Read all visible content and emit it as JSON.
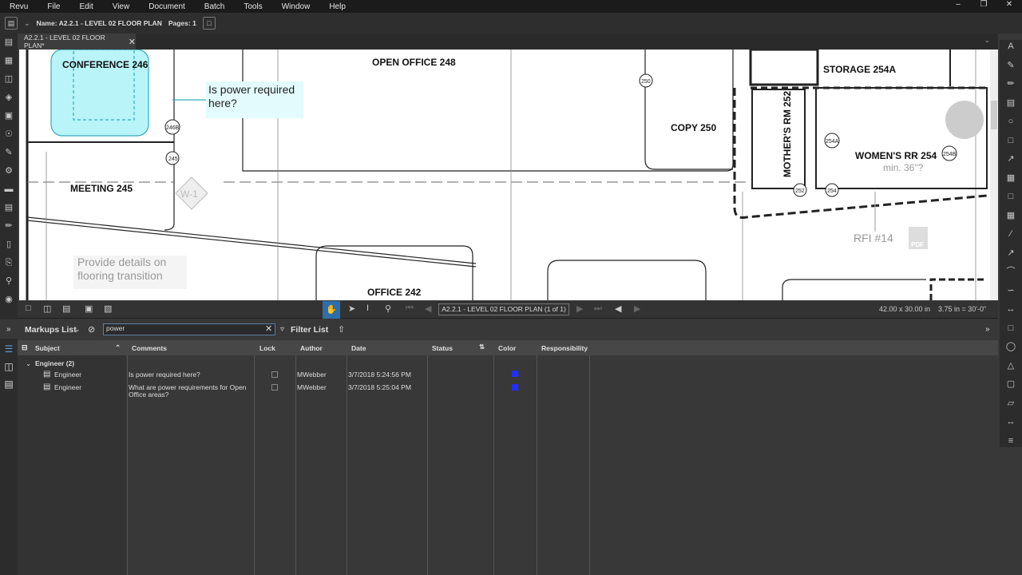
{
  "menu": [
    "Revu",
    "File",
    "Edit",
    "View",
    "Document",
    "Batch",
    "Tools",
    "Window",
    "Help"
  ],
  "toolbar": {
    "name_label": "Name: A2.2.1 - LEVEL 02 FLOOR PLAN",
    "pages_label": "Pages: 1"
  },
  "tab": {
    "label": "A2.2.1 - LEVEL 02 FLOOR PLAN*"
  },
  "drawing": {
    "rooms": [
      "CONFERENCE 246",
      "OPEN OFFICE 248",
      "COPY 250",
      "STORAGE 254A",
      "MOTHER'S RM 252",
      "WOMEN'S RR 254",
      "MEETING 245",
      "OFFICE 242"
    ],
    "tags": [
      "250",
      "246B",
      "245",
      "254A",
      "254B",
      "252",
      "254"
    ],
    "callout1": [
      "Is power required",
      "here?"
    ],
    "callout2": [
      "Provide details on",
      "flooring transition"
    ],
    "rfi": "RFI #14",
    "cloud_note": "min. 36\"?",
    "wall_tag": "W-1",
    "pdf_icon_label": "PDF"
  },
  "nav": {
    "page": "A2.2.1 - LEVEL 02 FLOOR PLAN (1 of 1)",
    "size": "42.00 x 30.00 in",
    "scale": "3.75 in = 30'-0\""
  },
  "markups": {
    "title": "Markups List",
    "search_value": "power",
    "filter_label": "Filter List",
    "columns": [
      "Subject",
      "Comments",
      "Lock",
      "Author",
      "Date",
      "Status",
      "Color",
      "Responsibility"
    ],
    "group": "Engineer (2)",
    "rows": [
      {
        "subject": "Engineer",
        "comment": "Is power required here?",
        "comment2": "",
        "author": "MWebber",
        "date": "3/7/2018 5:24:56 PM",
        "color": "#1f2fff"
      },
      {
        "subject": "Engineer",
        "comment": "What are power requirements for Open",
        "comment2": "Office areas?",
        "author": "MWebber",
        "date": "3/7/2018 5:25:04 PM",
        "color": "#1f2fff"
      }
    ]
  }
}
